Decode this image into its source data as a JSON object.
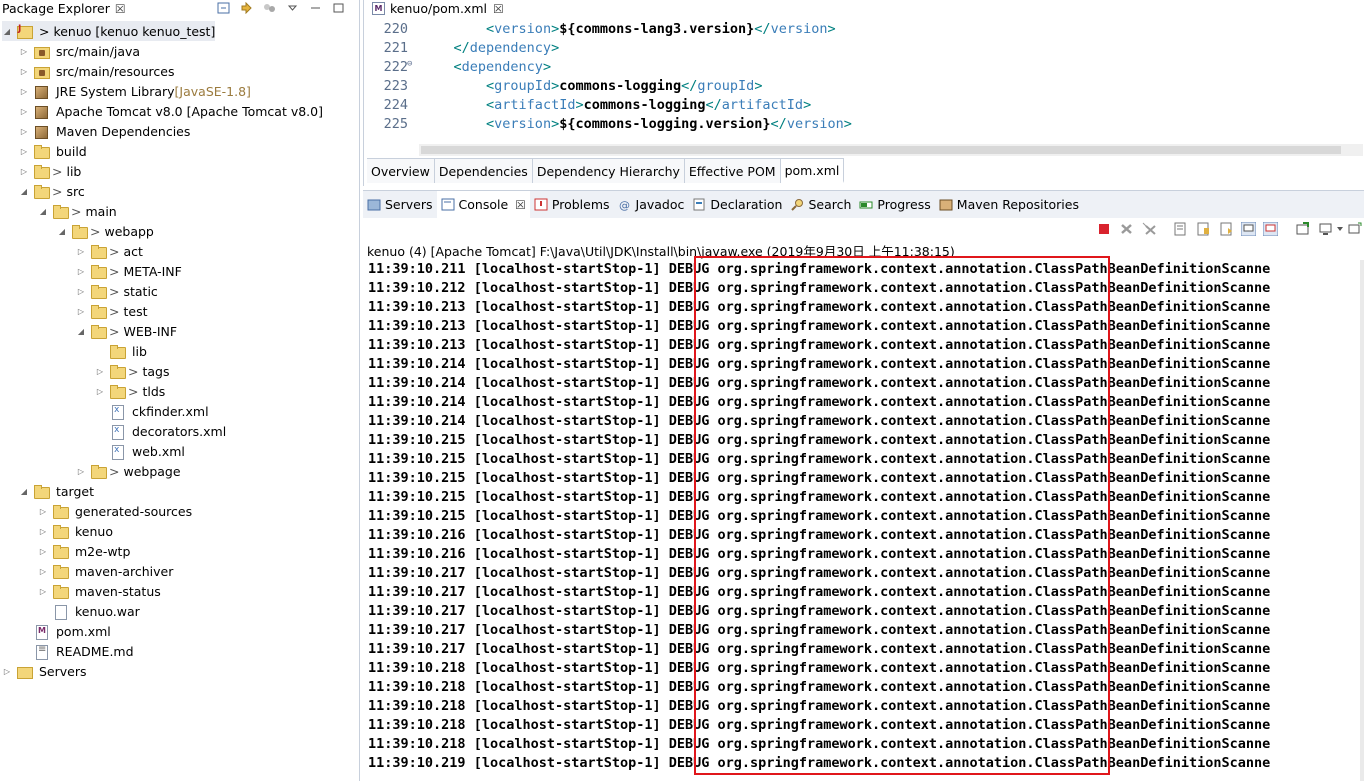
{
  "explorer": {
    "title": "Package Explorer",
    "close": "☒",
    "items": [
      {
        "label": "> kenuo [kenuo kenuo_test]",
        "prefix": "",
        "suffix": "",
        "arrow": "◢",
        "icon": "project"
      },
      {
        "label": "src/main/java",
        "prefix": "",
        "suffix": "",
        "arrow": "▷",
        "icon": "pkg"
      },
      {
        "label": "src/main/resources",
        "prefix": "",
        "suffix": "",
        "arrow": "▷",
        "icon": "pkg"
      },
      {
        "label": "JRE System Library ",
        "prefix": "",
        "suffix": "[JavaSE-1.8]",
        "arrow": "▷",
        "icon": "lib"
      },
      {
        "label": "Apache Tomcat v8.0 [Apache Tomcat v8.0]",
        "prefix": "",
        "suffix": "",
        "arrow": "▷",
        "icon": "lib"
      },
      {
        "label": "Maven Dependencies",
        "prefix": "",
        "suffix": "",
        "arrow": "▷",
        "icon": "lib"
      },
      {
        "label": "build",
        "prefix": "",
        "suffix": "",
        "arrow": "▷",
        "icon": "folder"
      },
      {
        "label": "lib",
        "prefix": ">",
        "suffix": "",
        "arrow": "▷",
        "icon": "folder"
      },
      {
        "label": "src",
        "prefix": ">",
        "suffix": "",
        "arrow": "◢",
        "icon": "folder"
      },
      {
        "label": "main",
        "prefix": ">",
        "suffix": "",
        "arrow": "◢",
        "icon": "folder"
      },
      {
        "label": "webapp",
        "prefix": ">",
        "suffix": "",
        "arrow": "◢",
        "icon": "folder"
      },
      {
        "label": "act",
        "prefix": ">",
        "suffix": "",
        "arrow": "▷",
        "icon": "folder"
      },
      {
        "label": "META-INF",
        "prefix": ">",
        "suffix": "",
        "arrow": "▷",
        "icon": "folder"
      },
      {
        "label": "static",
        "prefix": ">",
        "suffix": "",
        "arrow": "▷",
        "icon": "folder"
      },
      {
        "label": "test",
        "prefix": ">",
        "suffix": "",
        "arrow": "▷",
        "icon": "folder"
      },
      {
        "label": "WEB-INF",
        "prefix": ">",
        "suffix": "",
        "arrow": "◢",
        "icon": "folder"
      },
      {
        "label": "lib",
        "prefix": "",
        "suffix": "",
        "arrow": "",
        "icon": "folder"
      },
      {
        "label": "tags",
        "prefix": ">",
        "suffix": "",
        "arrow": "▷",
        "icon": "folder"
      },
      {
        "label": "tlds",
        "prefix": ">",
        "suffix": "",
        "arrow": "▷",
        "icon": "folder"
      },
      {
        "label": "ckfinder.xml",
        "prefix": "",
        "suffix": "",
        "arrow": "",
        "icon": "xml"
      },
      {
        "label": "decorators.xml",
        "prefix": "",
        "suffix": "",
        "arrow": "",
        "icon": "xml"
      },
      {
        "label": "web.xml",
        "prefix": "",
        "suffix": "",
        "arrow": "",
        "icon": "xml"
      },
      {
        "label": "webpage",
        "prefix": ">",
        "suffix": "",
        "arrow": "▷",
        "icon": "folder"
      },
      {
        "label": "target",
        "prefix": "",
        "suffix": "",
        "arrow": "◢",
        "icon": "folder"
      },
      {
        "label": "generated-sources",
        "prefix": "",
        "suffix": "",
        "arrow": "▷",
        "icon": "folder"
      },
      {
        "label": "kenuo",
        "prefix": "",
        "suffix": "",
        "arrow": "▷",
        "icon": "folder"
      },
      {
        "label": "m2e-wtp",
        "prefix": "",
        "suffix": "",
        "arrow": "▷",
        "icon": "folder"
      },
      {
        "label": "maven-archiver",
        "prefix": "",
        "suffix": "",
        "arrow": "▷",
        "icon": "folder"
      },
      {
        "label": "maven-status",
        "prefix": "",
        "suffix": "",
        "arrow": "▷",
        "icon": "folder"
      },
      {
        "label": "kenuo.war",
        "prefix": "",
        "suffix": "",
        "arrow": "",
        "icon": "war"
      },
      {
        "label": "pom.xml",
        "prefix": "",
        "suffix": "",
        "arrow": "",
        "icon": "pom"
      },
      {
        "label": "README.md",
        "prefix": "",
        "suffix": "",
        "arrow": "",
        "icon": "md"
      },
      {
        "label": "Servers",
        "prefix": "",
        "suffix": "",
        "arrow": "▷",
        "icon": "server"
      }
    ]
  },
  "editor": {
    "tab_label": "kenuo/pom.xml",
    "tab_close": "☒",
    "lines": [
      {
        "num": "220",
        "fold": "",
        "indent": "        ",
        "name": "version",
        "value": "${commons-lang3.version}",
        "type": "full"
      },
      {
        "num": "221",
        "fold": "",
        "indent": "    ",
        "name": "dependency",
        "value": "",
        "type": "close"
      },
      {
        "num": "222",
        "fold": "⊖",
        "indent": "    ",
        "name": "dependency",
        "value": "",
        "type": "open"
      },
      {
        "num": "223",
        "fold": "",
        "indent": "        ",
        "name": "groupId",
        "value": "commons-logging",
        "type": "full"
      },
      {
        "num": "224",
        "fold": "",
        "indent": "        ",
        "name": "artifactId",
        "value": "commons-logging",
        "type": "full"
      },
      {
        "num": "225",
        "fold": "",
        "indent": "        ",
        "name": "version",
        "value": "${commons-logging.version}",
        "type": "full"
      }
    ],
    "bottom_tabs": [
      "Overview",
      "Dependencies",
      "Dependency Hierarchy",
      "Effective POM",
      "pom.xml"
    ],
    "active_bottom_tab": "pom.xml"
  },
  "views": {
    "tabs": [
      {
        "label": "Servers",
        "icon": "servers-icon"
      },
      {
        "label": "Console",
        "icon": "console-icon"
      },
      {
        "label": "Problems",
        "icon": "problems-icon"
      },
      {
        "label": "Javadoc",
        "icon": "javadoc-icon"
      },
      {
        "label": "Declaration",
        "icon": "declaration-icon"
      },
      {
        "label": "Search",
        "icon": "search-icon"
      },
      {
        "label": "Progress",
        "icon": "progress-icon"
      },
      {
        "label": "Maven Repositories",
        "icon": "maven-repositories-icon"
      }
    ],
    "active_tab": "Console",
    "console_close": "☒",
    "console_title": "kenuo (4) [Apache Tomcat] F:\\Java\\Util\\JDK\\Install\\bin\\javaw.exe (2019年9月30日 上午11:38:15)",
    "log_thread": "[localhost-startStop-1]",
    "log_level": "DEBUG",
    "log_logger": "org.springframework.context.annotation.",
    "log_class": "ClassPathBeanDefinitionScanne",
    "log_times": [
      "11:39:10.211",
      "11:39:10.212",
      "11:39:10.213",
      "11:39:10.213",
      "11:39:10.213",
      "11:39:10.214",
      "11:39:10.214",
      "11:39:10.214",
      "11:39:10.214",
      "11:39:10.215",
      "11:39:10.215",
      "11:39:10.215",
      "11:39:10.215",
      "11:39:10.215",
      "11:39:10.216",
      "11:39:10.216",
      "11:39:10.217",
      "11:39:10.217",
      "11:39:10.217",
      "11:39:10.217",
      "11:39:10.217",
      "11:39:10.218",
      "11:39:10.218",
      "11:39:10.218",
      "11:39:10.218",
      "11:39:10.218",
      "11:39:10.219"
    ]
  },
  "colors": {
    "highlight_box": "#e0161b",
    "xml_tag": "#3a7db8",
    "xml_bracket": "#008080",
    "line_number": "#5a6e8a",
    "jre_suffix": "#9b7b3e"
  }
}
